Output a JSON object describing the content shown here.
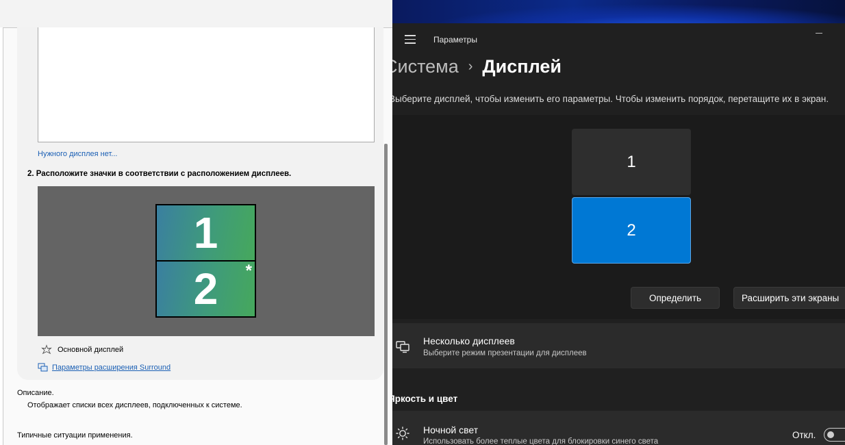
{
  "nvidia_panel": {
    "missing_display_link": "Нужного дисплея нет...",
    "step2_title": "2. Расположите значки в соответствии с расположением дисплеев.",
    "monitors": [
      {
        "label": "1",
        "primary": false
      },
      {
        "label": "2",
        "primary": true,
        "primary_marker": "*"
      }
    ],
    "primary_legend": "Основной дисплей",
    "surround_link": "Параметры расширения Surround",
    "description_heading": "Описание.",
    "description_text": "Отображает списки всех дисплеев, подключенных к системе.",
    "typical_usage_heading": "Типичные ситуации применения."
  },
  "settings": {
    "app_title": "Параметры",
    "breadcrumb": {
      "parent": "Система",
      "separator": "›",
      "current": "Дисплей"
    },
    "select_display_hint": "Выберите дисплей, чтобы изменить его параметры. Чтобы изменить порядок, перетащите их в экран.",
    "displays": [
      {
        "label": "1",
        "selected": false
      },
      {
        "label": "2",
        "selected": true
      }
    ],
    "identify_button": "Определить",
    "extend_button": "Расширить эти экраны",
    "multiple_displays": {
      "title": "Несколько дисплеев",
      "subtitle": "Выберите режим презентации для дисплеев",
      "icon": "multiple-displays-icon"
    },
    "brightness_section": "Яркость и цвет",
    "night_light": {
      "title": "Ночной свет",
      "subtitle": "Использовать более теплые цвета для блокировки синего света",
      "icon": "brightness-icon",
      "state_label": "Откл.",
      "enabled": false
    },
    "colors": {
      "accent": "#0078d4",
      "background": "#202020",
      "card": "#2b2b2b"
    }
  }
}
